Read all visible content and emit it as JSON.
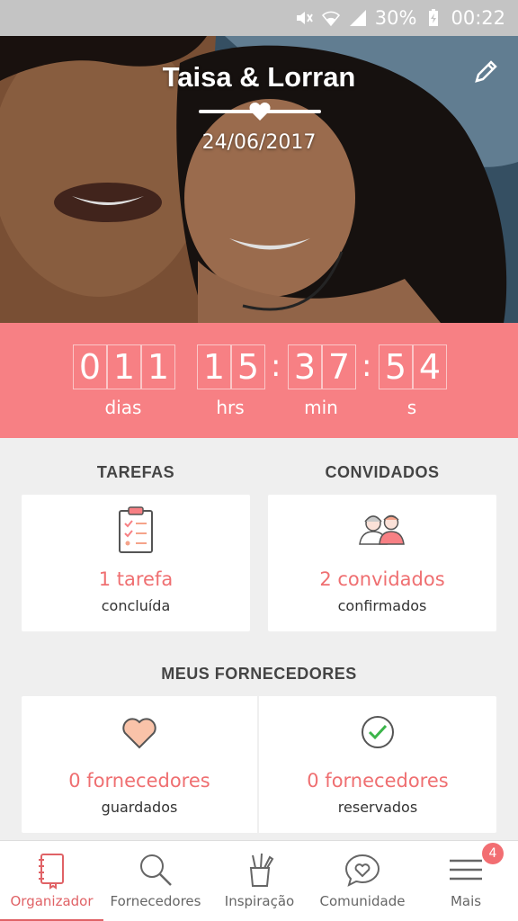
{
  "status_bar": {
    "battery": "30%",
    "time": "00:22",
    "icons": [
      "mute-icon",
      "wifi-icon",
      "signal-icon",
      "battery-charging-icon"
    ]
  },
  "hero": {
    "couple_names": "Taisa & Lorran",
    "wedding_date": "24/06/2017",
    "icons": [
      "heart-divider-icon",
      "edit-pencil-icon"
    ]
  },
  "countdown": {
    "days_digits": [
      "0",
      "1",
      "1"
    ],
    "hours_digits": [
      "1",
      "5"
    ],
    "minutes_digits": [
      "3",
      "7"
    ],
    "seconds_digits": [
      "5",
      "4"
    ],
    "separator": ":",
    "labels": {
      "days": "dias",
      "hours": "hrs",
      "minutes": "min",
      "seconds": "s"
    }
  },
  "tasks": {
    "title": "TAREFAS",
    "value": "1 tarefa",
    "caption": "concluída",
    "icon": "clipboard-checklist-icon"
  },
  "guests": {
    "title": "CONVIDADOS",
    "value": "2 convidados",
    "caption": "confirmados",
    "icon": "guests-couple-icon"
  },
  "vendors": {
    "title": "MEUS FORNECEDORES",
    "saved": {
      "value": "0 fornecedores",
      "caption": "guardados",
      "icon": "heart-icon"
    },
    "booked": {
      "value": "0 fornecedores",
      "caption": "reservados",
      "icon": "check-circle-icon"
    }
  },
  "bottom_nav": {
    "items": [
      {
        "label": "Organizador",
        "icon": "notebook-icon",
        "active": true
      },
      {
        "label": "Fornecedores",
        "icon": "search-icon",
        "active": false
      },
      {
        "label": "Inspiração",
        "icon": "pencil-cup-icon",
        "active": false
      },
      {
        "label": "Comunidade",
        "icon": "chat-heart-icon",
        "active": false
      },
      {
        "label": "Mais",
        "icon": "menu-icon",
        "active": false,
        "badge": "4"
      }
    ]
  },
  "colors": {
    "accent": "#f78084",
    "accent_text": "#ef6f71",
    "background": "#efefef",
    "status_bar": "#c4c4c4"
  }
}
